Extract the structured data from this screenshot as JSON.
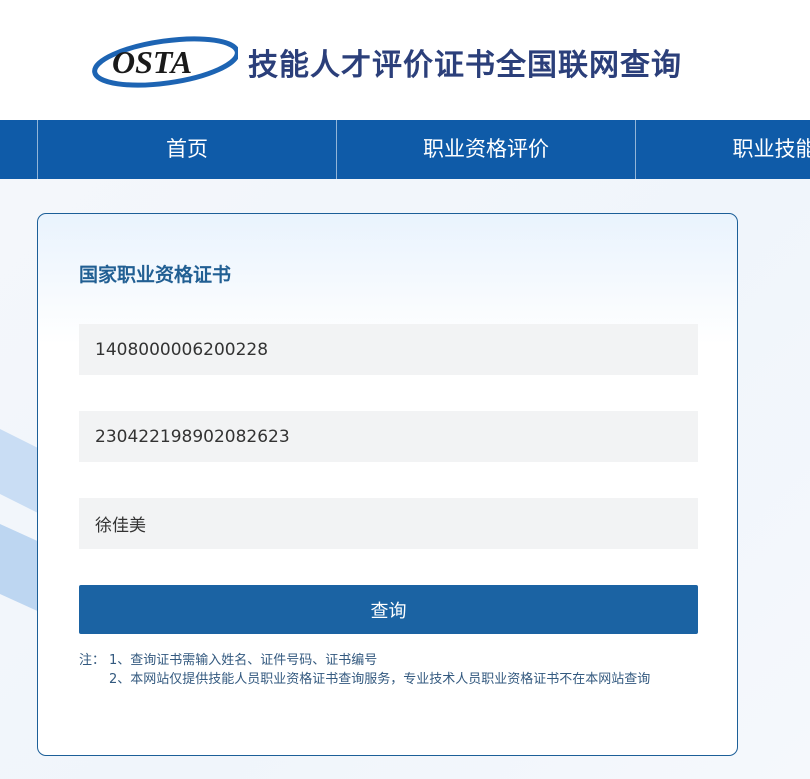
{
  "header": {
    "logo_text": "OSTA",
    "site_title": "技能人才评价证书全国联网查询"
  },
  "nav": {
    "items": [
      {
        "label": "首页"
      },
      {
        "label": "职业资格评价"
      },
      {
        "label": "职业技能等"
      }
    ]
  },
  "card": {
    "title": "国家职业资格证书",
    "fields": {
      "certificate_number": "1408000006200228",
      "id_number": "230422198902082623",
      "name": "徐佳美"
    },
    "submit_label": "查询",
    "notes": {
      "prefix": "注：",
      "lines": [
        "1、查询证书需输入姓名、证件号码、证书编号",
        "2、本网站仅提供技能人员职业资格证书查询服务，专业技术人员职业资格证书不在本网站查询"
      ]
    }
  },
  "colors": {
    "nav_bg": "#0f5ba8",
    "button_bg": "#1b63a3",
    "card_border": "#1c5f98",
    "title_color": "#215f93"
  }
}
